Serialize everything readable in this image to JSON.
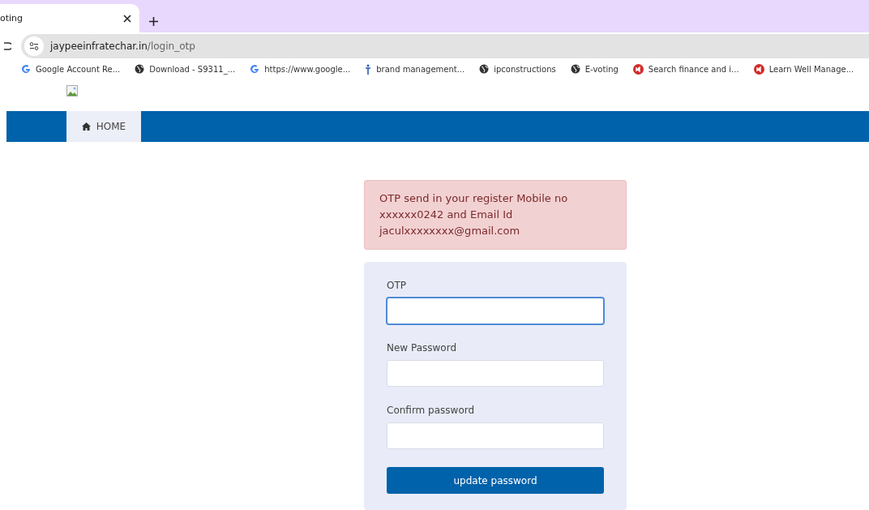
{
  "browser": {
    "tab": {
      "title": "oting",
      "selected": true
    },
    "address": {
      "domain": "jaypeeinfratechar.in",
      "path": "/login_otp"
    },
    "bookmarks": [
      {
        "label": "Google Account Re...",
        "kind": "google"
      },
      {
        "label": "Download - S9311_...",
        "kind": "globe"
      },
      {
        "label": "https://www.google...",
        "kind": "google"
      },
      {
        "label": "brand management...",
        "kind": "info"
      },
      {
        "label": "ipconstructions",
        "kind": "globe"
      },
      {
        "label": "E-voting",
        "kind": "globe"
      },
      {
        "label": "Search finance and i...",
        "kind": "red"
      },
      {
        "label": "Learn Well Manage...",
        "kind": "red"
      }
    ]
  },
  "nav": {
    "items": [
      {
        "label": "HOME",
        "selected": true
      }
    ]
  },
  "alert": {
    "lines": [
      "OTP send in your register Mobile no",
      "xxxxxx0242 and Email Id",
      "jaculxxxxxxxx@gmail.com"
    ]
  },
  "form": {
    "fields": [
      {
        "label": "OTP",
        "focused": true
      },
      {
        "label": "New Password",
        "focused": false
      },
      {
        "label": "Confirm password",
        "focused": false
      }
    ],
    "submit": "update password"
  }
}
